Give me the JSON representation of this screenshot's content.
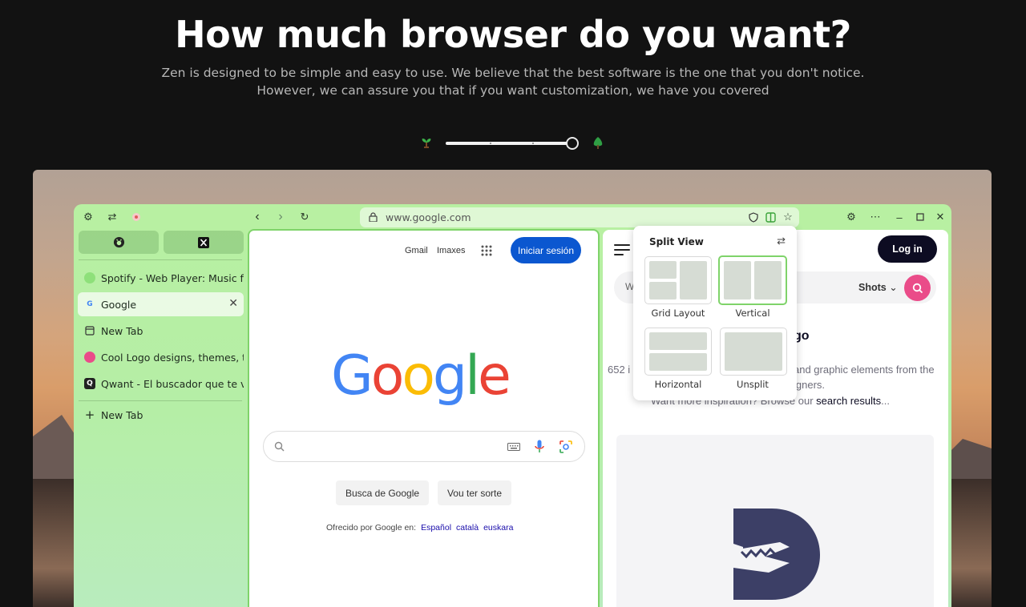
{
  "hero": {
    "title": "How much browser do you want?",
    "subtitle_line1": "Zen is designed to be simple and easy to use. We believe that the best software is the one that you don't notice.",
    "subtitle_line2": "However, we can assure you that if you want customization, we have you covered"
  },
  "slider": {
    "level": 1.0,
    "min_icon": "sprout-icon",
    "max_icon": "tree-icon"
  },
  "browser": {
    "url": "www.google.com",
    "accent": "#7fd36a",
    "pinned": [
      {
        "name": "github-icon"
      },
      {
        "name": "x-icon"
      }
    ],
    "tabs": [
      {
        "label": "Spotify - Web Player: Music for e",
        "icon": "spotify-icon",
        "active": false
      },
      {
        "label": "Google",
        "icon": "google-icon",
        "active": true
      },
      {
        "label": "New Tab",
        "icon": "newtab-icon",
        "active": false
      },
      {
        "label": "Cool Logo designs, themes, tem",
        "icon": "dribbble-icon",
        "active": false
      },
      {
        "label": "Qwant - El buscador que te valo",
        "icon": "qwant-icon",
        "active": false
      }
    ],
    "new_tab_label": "New Tab"
  },
  "google": {
    "gmail": "Gmail",
    "images": "Imaxes",
    "signin": "Iniciar sesión",
    "logo": "Google",
    "search_btn": "Busca de Google",
    "lucky_btn": "Vou ter sorte",
    "offered": "Ofrecido por Google en:",
    "langs": [
      "Español",
      "català",
      "euskara"
    ]
  },
  "dribbble": {
    "login": "Log in",
    "search_prefix": "W",
    "shots": "Shots",
    "heading_tail": "go",
    "count_prefix": "652 i",
    "line1_tail": "and graphic elements from the",
    "line2_tail": "igners.",
    "line3_prefix": "Want more inspiration? Browse our ",
    "line3_link": "search results",
    "line3_suffix": "..."
  },
  "split_view": {
    "title": "Split View",
    "options": [
      {
        "label": "Grid Layout",
        "selected": false
      },
      {
        "label": "Vertical",
        "selected": true
      },
      {
        "label": "Horizontal",
        "selected": false
      },
      {
        "label": "Unsplit",
        "selected": false
      }
    ]
  }
}
